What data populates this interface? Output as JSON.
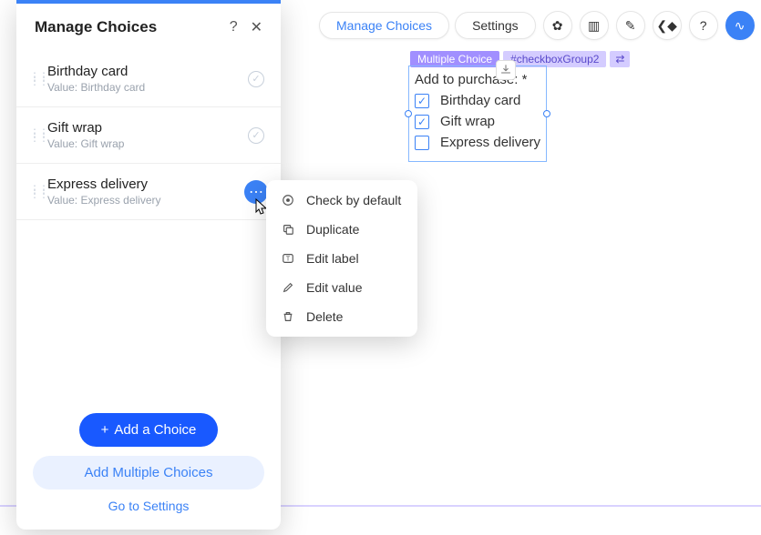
{
  "panel": {
    "title": "Manage Choices",
    "choices": [
      {
        "label": "Birthday card",
        "valuePrefix": "Value: ",
        "value": "Birthday card",
        "checked": true,
        "menuOpen": false
      },
      {
        "label": "Gift wrap",
        "valuePrefix": "Value: ",
        "value": "Gift wrap",
        "checked": true,
        "menuOpen": false
      },
      {
        "label": "Express delivery",
        "valuePrefix": "Value: ",
        "value": "Express delivery",
        "checked": false,
        "menuOpen": true
      }
    ],
    "addChoice": "Add a Choice",
    "addMultiple": "Add Multiple Choices",
    "goToSettings": "Go to Settings"
  },
  "toolbar": {
    "manageChoices": "Manage Choices",
    "settings": "Settings"
  },
  "element": {
    "typeBadge": "Multiple Choice",
    "idBadge": "#checkboxGroup2",
    "title": "Add to purchase: *",
    "options": [
      {
        "label": "Birthday card",
        "checked": true
      },
      {
        "label": "Gift wrap",
        "checked": true
      },
      {
        "label": "Express delivery",
        "checked": false
      }
    ]
  },
  "contextMenu": {
    "checkDefault": "Check by default",
    "duplicate": "Duplicate",
    "editLabel": "Edit label",
    "editValue": "Edit value",
    "delete": "Delete"
  }
}
